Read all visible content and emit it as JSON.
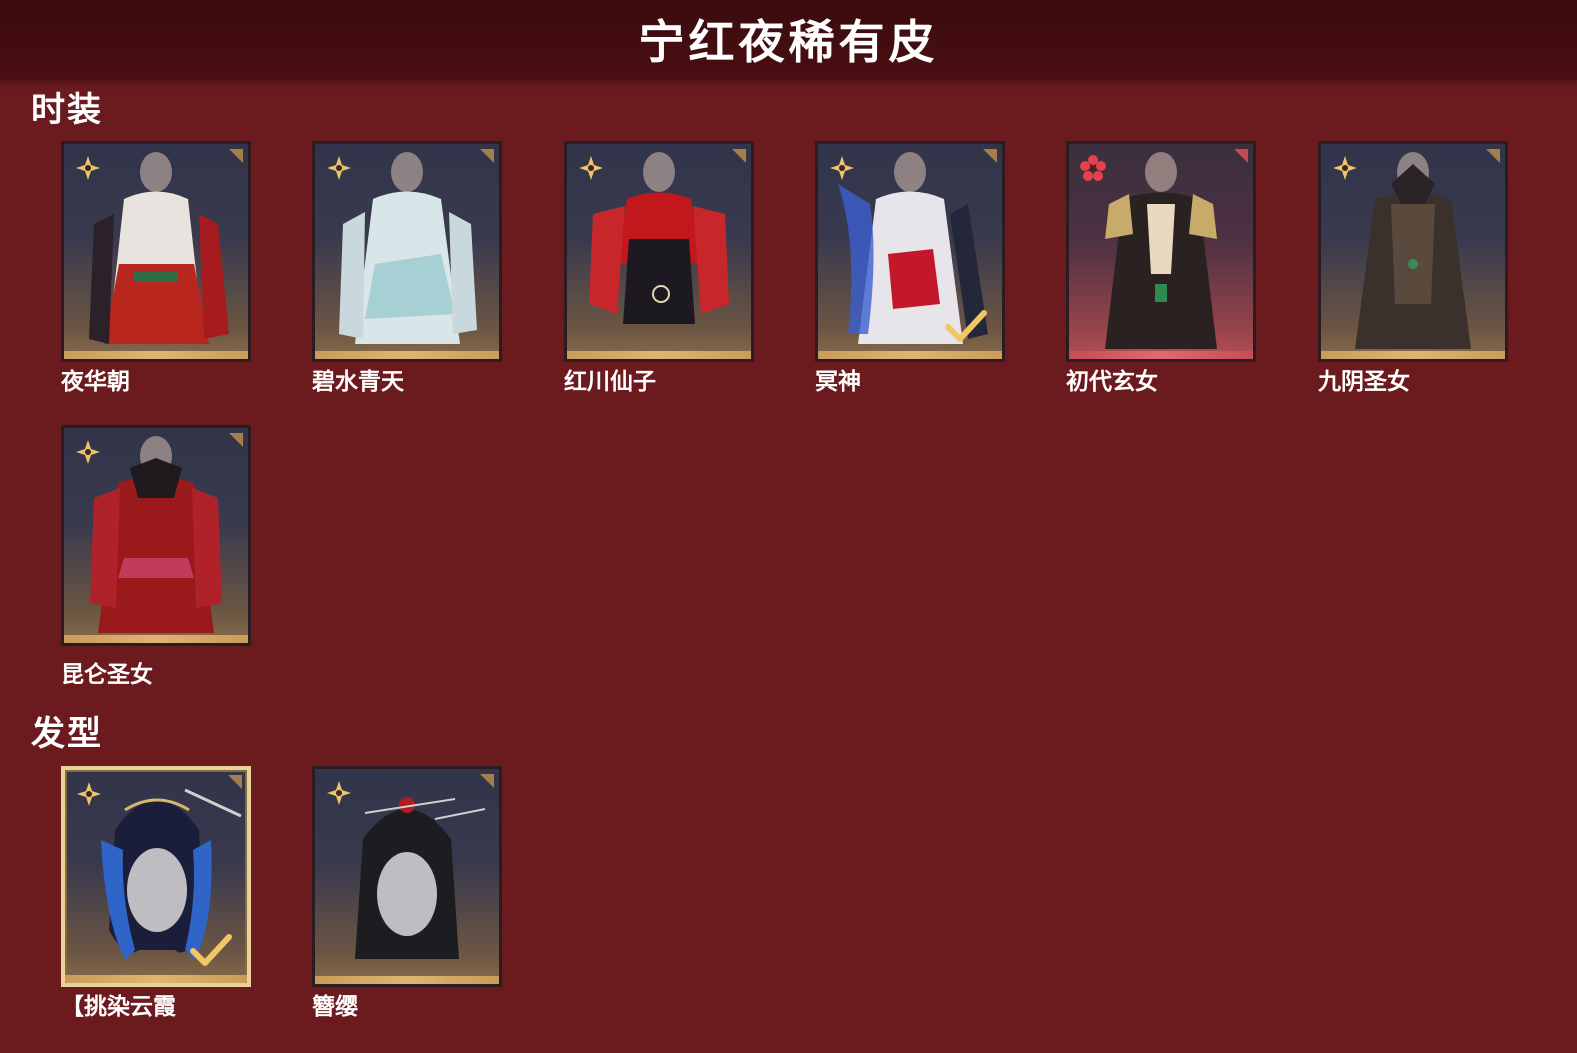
{
  "page": {
    "title": "宁红夜稀有皮"
  },
  "sections": {
    "outfits": {
      "title": "时装",
      "items": [
        {
          "name": "夜华朝",
          "rarity": "gold",
          "owned": false
        },
        {
          "name": "碧水青天",
          "rarity": "gold",
          "owned": false
        },
        {
          "name": "红川仙子",
          "rarity": "gold",
          "owned": false
        },
        {
          "name": "冥神",
          "rarity": "gold",
          "owned": true
        },
        {
          "name": "初代玄女",
          "rarity": "red",
          "owned": false
        },
        {
          "name": "九阴圣女",
          "rarity": "gold",
          "owned": false
        },
        {
          "name": "昆仑圣女",
          "rarity": "gold",
          "owned": false
        }
      ]
    },
    "hairstyles": {
      "title": "发型",
      "items": [
        {
          "name": "【挑染云霞",
          "rarity": "gold",
          "owned": true,
          "selected": true
        },
        {
          "name": "簪缨",
          "rarity": "gold",
          "owned": false
        }
      ]
    }
  },
  "colors": {
    "background": "#6b1a1e",
    "header": "#3b0b0d",
    "gold_accent": "#e0b571",
    "red_accent": "#e16a6f"
  },
  "icons": {
    "gold_rarity": "four-petal-star-icon",
    "red_rarity": "five-petal-flower-icon",
    "owned": "checkmark-icon",
    "corner": "corner-ornament-icon"
  }
}
